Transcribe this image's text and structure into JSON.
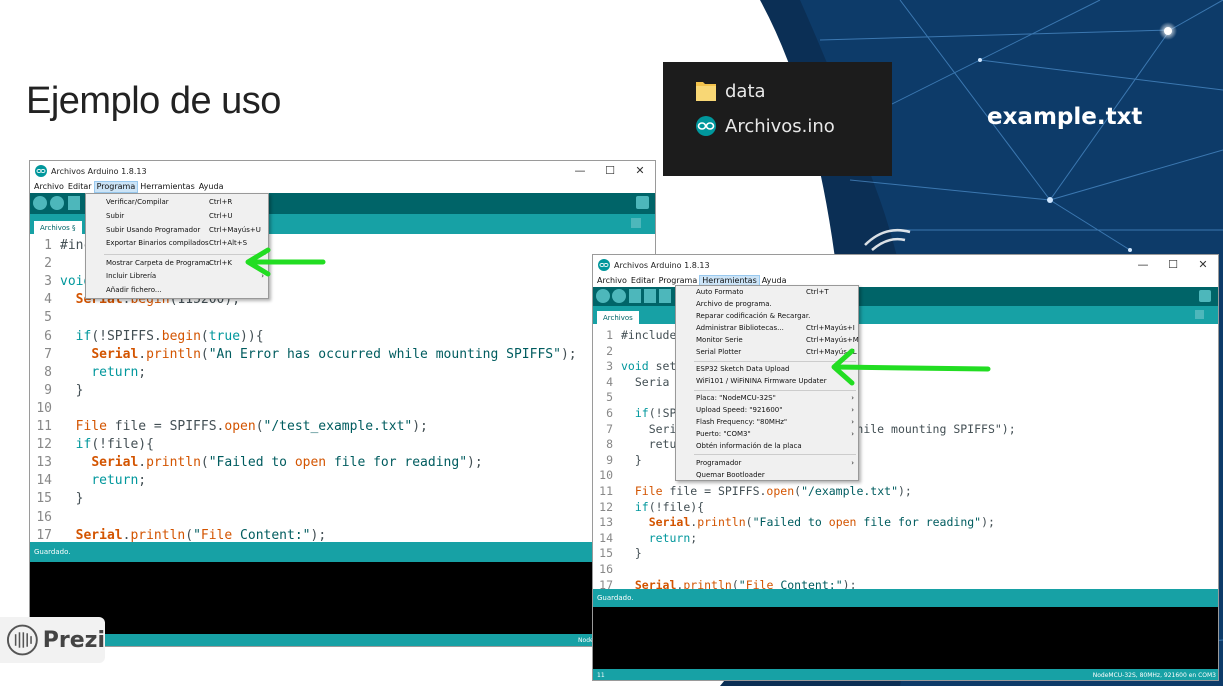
{
  "slide": {
    "title": "Ejemplo de uso",
    "example_label": "example.txt",
    "prezi_label": "Prezi"
  },
  "explorer": {
    "items": [
      {
        "name": "data",
        "icon": "folder-icon"
      },
      {
        "name": "Archivos.ino",
        "icon": "arduino-icon"
      }
    ]
  },
  "ide1": {
    "title": "Archivos Arduino 1.8.13",
    "menu": [
      "Archivo",
      "Editar",
      "Programa",
      "Herramientas",
      "Ayuda"
    ],
    "active_menu": "Programa",
    "tab": "Archivos §",
    "status": "Guardado.",
    "footer": "NodeMCU-32S, 80MHz, 9",
    "dropdown": [
      {
        "label": "Verificar/Compilar",
        "shortcut": "Ctrl+R"
      },
      {
        "label": "Subir",
        "shortcut": "Ctrl+U"
      },
      {
        "label": "Subir Usando Programador",
        "shortcut": "Ctrl+Mayús+U"
      },
      {
        "label": "Exportar Binarios compilados",
        "shortcut": "Ctrl+Alt+S"
      },
      {
        "label": "Mostrar Carpeta de Programa",
        "shortcut": "Ctrl+K"
      },
      {
        "label": "Incluir Librería",
        "shortcut": "›"
      },
      {
        "label": "Añadir fichero...",
        "shortcut": ""
      }
    ],
    "code": [
      {
        "n": "1",
        "text": "#inc"
      },
      {
        "n": "2",
        "text": ""
      },
      {
        "n": "3",
        "text": "void"
      },
      {
        "n": "4",
        "text": "  Serial.begin(115200);"
      },
      {
        "n": "5",
        "text": ""
      },
      {
        "n": "6",
        "text": "  if(!SPIFFS.begin(true)){"
      },
      {
        "n": "7",
        "text": "    Serial.println(\"An Error has occurred while mounting SPIFFS\");"
      },
      {
        "n": "8",
        "text": "    return;"
      },
      {
        "n": "9",
        "text": "  }"
      },
      {
        "n": "10",
        "text": ""
      },
      {
        "n": "11",
        "text": "  File file = SPIFFS.open(\"/test_example.txt\");"
      },
      {
        "n": "12",
        "text": "  if(!file){"
      },
      {
        "n": "13",
        "text": "    Serial.println(\"Failed to open file for reading\");"
      },
      {
        "n": "14",
        "text": "    return;"
      },
      {
        "n": "15",
        "text": "  }"
      },
      {
        "n": "16",
        "text": ""
      },
      {
        "n": "17",
        "text": "  Serial.println(\"File Content:\");"
      }
    ]
  },
  "ide2": {
    "title": "Archivos Arduino 1.8.13",
    "menu": [
      "Archivo",
      "Editar",
      "Programa",
      "Herramientas",
      "Ayuda"
    ],
    "active_menu": "Herramientas",
    "tab": "Archivos",
    "status": "Guardado.",
    "footer": "NodeMCU-32S, 80MHz, 921600 en COM3",
    "footer_left": "11",
    "dropdown": [
      {
        "label": "Auto Formato",
        "shortcut": "Ctrl+T"
      },
      {
        "label": "Archivo de programa.",
        "shortcut": ""
      },
      {
        "label": "Reparar codificación & Recargar.",
        "shortcut": ""
      },
      {
        "label": "Administrar Bibliotecas...",
        "shortcut": "Ctrl+Mayús+I"
      },
      {
        "label": "Monitor Serie",
        "shortcut": "Ctrl+Mayús+M"
      },
      {
        "label": "Serial Plotter",
        "shortcut": "Ctrl+Mayús+L"
      },
      {
        "label": "ESP32 Sketch Data Upload",
        "shortcut": ""
      },
      {
        "label": "WiFi101 / WiFiNINA Firmware Updater",
        "shortcut": ""
      },
      {
        "label": "Placa: \"NodeMCU-32S\"",
        "shortcut": "›"
      },
      {
        "label": "Upload Speed: \"921600\"",
        "shortcut": "›"
      },
      {
        "label": "Flash Frequency: \"80MHz\"",
        "shortcut": "›"
      },
      {
        "label": "Puerto: \"COM3\"",
        "shortcut": "›"
      },
      {
        "label": "Obtén información de la placa",
        "shortcut": ""
      },
      {
        "label": "Programador",
        "shortcut": "›"
      },
      {
        "label": "Quemar Bootloader",
        "shortcut": ""
      }
    ],
    "code": [
      {
        "n": "1",
        "text": "#include"
      },
      {
        "n": "2",
        "text": ""
      },
      {
        "n": "3",
        "text": "void set"
      },
      {
        "n": "4",
        "text": "  Seria"
      },
      {
        "n": "5",
        "text": ""
      },
      {
        "n": "6",
        "text": "  if(!SP"
      },
      {
        "n": "7",
        "text": "    Seri                 ccurred while mounting SPIFFS\");"
      },
      {
        "n": "8",
        "text": "    retu"
      },
      {
        "n": "9",
        "text": "  }"
      },
      {
        "n": "10",
        "text": ""
      },
      {
        "n": "11",
        "text": "  File file = SPIFFS.open(\"/example.txt\");"
      },
      {
        "n": "12",
        "text": "  if(!file){"
      },
      {
        "n": "13",
        "text": "    Serial.println(\"Failed to open file for reading\");"
      },
      {
        "n": "14",
        "text": "    return;"
      },
      {
        "n": "15",
        "text": "  }"
      },
      {
        "n": "16",
        "text": ""
      },
      {
        "n": "17",
        "text": "  Serial.println(\"File Content:\");"
      }
    ]
  },
  "colors": {
    "arduino_dark": "#006468",
    "arduino_teal": "#17a1a5",
    "arrow_green": "#22dd22",
    "network_bg": "#0a2540"
  }
}
